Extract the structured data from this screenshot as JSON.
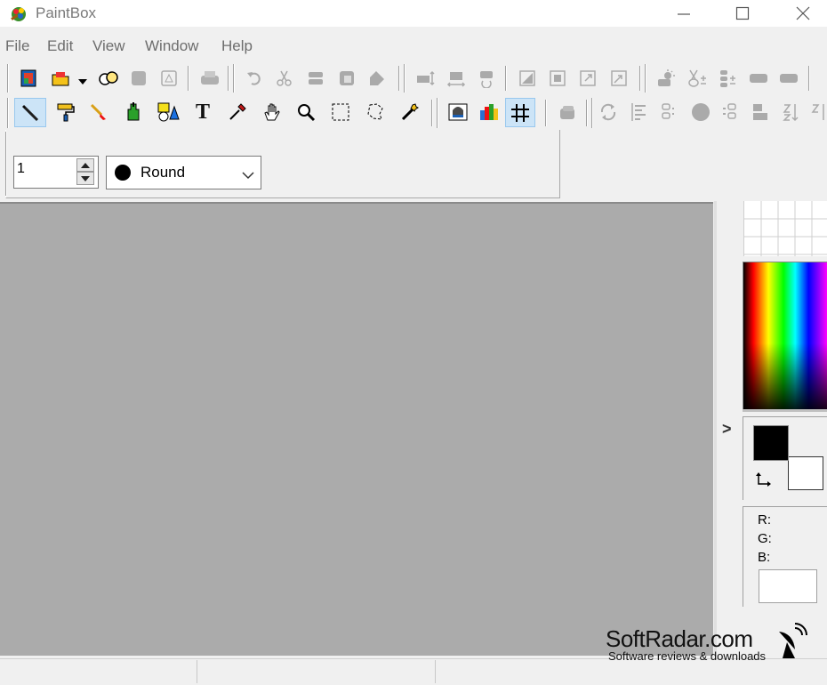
{
  "window": {
    "title": "PaintBox"
  },
  "menu": {
    "items": [
      "File",
      "Edit",
      "View",
      "Window",
      "Help"
    ]
  },
  "toolbar_main": {
    "buttons": [
      "new-icon",
      "open-icon",
      "open-dropdown-icon",
      "browse-icon",
      "save-icon",
      "save-as-icon",
      "print-icon",
      "undo-icon",
      "redo-icon",
      "cut-icon",
      "copy-icon",
      "paste-icon",
      "flip-vertical-icon",
      "flip-horizontal-icon",
      "rotate-icon",
      "crop-icon",
      "canvas-size-icon",
      "resize-icon",
      "stretch-icon",
      "brightness-icon",
      "contrast-icon",
      "levels-icon",
      "effect-icon",
      "filter-icon"
    ]
  },
  "toolbar_tools": {
    "active": "pencil",
    "buttons": [
      "pencil-icon",
      "paint-roller-icon",
      "brush-icon",
      "fill-icon",
      "shapes-icon",
      "text-icon",
      "eyedropper-icon",
      "hand-icon",
      "zoom-icon",
      "rect-select-icon",
      "lasso-icon",
      "magic-wand-icon",
      "image-icon",
      "palette-icon",
      "grid-icon",
      "layers-icon",
      "refresh-icon",
      "align-icon",
      "spacing-icon",
      "circle-icon",
      "distribute-icon",
      "stack-icon",
      "sort-icon",
      "more-icon"
    ],
    "text_tool_glyph": "T"
  },
  "options": {
    "size_value": "1",
    "brush_shape": "Round"
  },
  "colors": {
    "foreground": "#000000",
    "background": "#ffffff",
    "canvas": "#ababab"
  },
  "rgb_panel": {
    "r_label": "R:",
    "g_label": "G:",
    "b_label": "B:"
  },
  "panel_toggle_glyph": ">",
  "watermark": {
    "name": "SoftRadar.com",
    "tagline": "Software reviews & downloads"
  }
}
